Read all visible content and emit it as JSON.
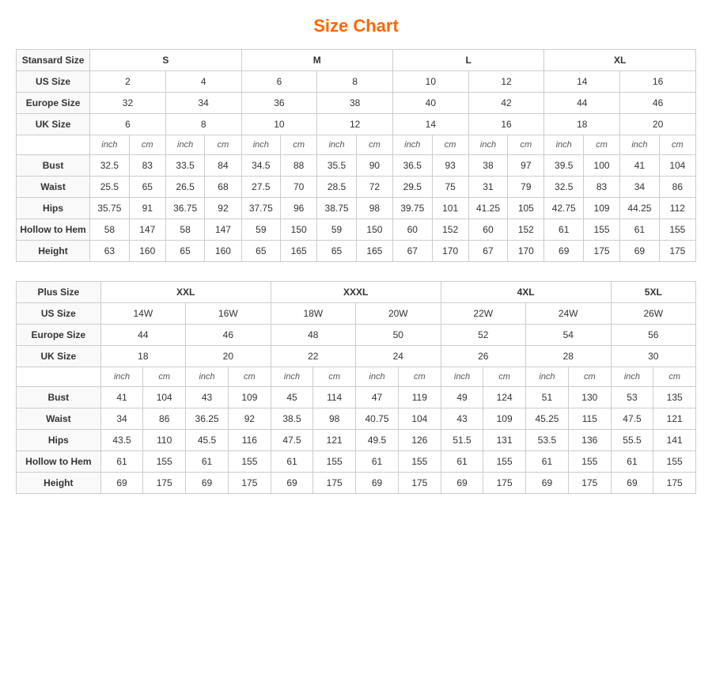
{
  "title": "Size Chart",
  "standard": {
    "label": "Stansard Size",
    "sizes": [
      "S",
      "M",
      "L",
      "XL"
    ],
    "us": [
      "2",
      "4",
      "6",
      "8",
      "10",
      "12",
      "14",
      "16"
    ],
    "europe": [
      "32",
      "34",
      "36",
      "38",
      "40",
      "42",
      "44",
      "46"
    ],
    "uk": [
      "6",
      "8",
      "10",
      "12",
      "14",
      "16",
      "18",
      "20"
    ],
    "measurements": {
      "bust": [
        "32.5",
        "83",
        "33.5",
        "84",
        "34.5",
        "88",
        "35.5",
        "90",
        "36.5",
        "93",
        "38",
        "97",
        "39.5",
        "100",
        "41",
        "104"
      ],
      "waist": [
        "25.5",
        "65",
        "26.5",
        "68",
        "27.5",
        "70",
        "28.5",
        "72",
        "29.5",
        "75",
        "31",
        "79",
        "32.5",
        "83",
        "34",
        "86"
      ],
      "hips": [
        "35.75",
        "91",
        "36.75",
        "92",
        "37.75",
        "96",
        "38.75",
        "98",
        "39.75",
        "101",
        "41.25",
        "105",
        "42.75",
        "109",
        "44.25",
        "112"
      ],
      "hollow": [
        "58",
        "147",
        "58",
        "147",
        "59",
        "150",
        "59",
        "150",
        "60",
        "152",
        "60",
        "152",
        "61",
        "155",
        "61",
        "155"
      ],
      "height": [
        "63",
        "160",
        "65",
        "160",
        "65",
        "165",
        "65",
        "165",
        "67",
        "170",
        "67",
        "170",
        "69",
        "175",
        "69",
        "175"
      ]
    }
  },
  "plus": {
    "label": "Plus Size",
    "sizes": [
      "XXL",
      "XXXL",
      "4XL",
      "5XL"
    ],
    "us": [
      "14W",
      "16W",
      "18W",
      "20W",
      "22W",
      "24W",
      "26W"
    ],
    "europe": [
      "44",
      "46",
      "48",
      "50",
      "52",
      "54",
      "56"
    ],
    "uk": [
      "18",
      "20",
      "22",
      "24",
      "26",
      "28",
      "30"
    ],
    "measurements": {
      "bust": [
        "41",
        "104",
        "43",
        "109",
        "45",
        "114",
        "47",
        "119",
        "49",
        "124",
        "51",
        "130",
        "53",
        "135"
      ],
      "waist": [
        "34",
        "86",
        "36.25",
        "92",
        "38.5",
        "98",
        "40.75",
        "104",
        "43",
        "109",
        "45.25",
        "115",
        "47.5",
        "121"
      ],
      "hips": [
        "43.5",
        "110",
        "45.5",
        "116",
        "47.5",
        "121",
        "49.5",
        "126",
        "51.5",
        "131",
        "53.5",
        "136",
        "55.5",
        "141"
      ],
      "hollow": [
        "61",
        "155",
        "61",
        "155",
        "61",
        "155",
        "61",
        "155",
        "61",
        "155",
        "61",
        "155",
        "61",
        "155"
      ],
      "height": [
        "69",
        "175",
        "69",
        "175",
        "69",
        "175",
        "69",
        "175",
        "69",
        "175",
        "69",
        "175",
        "69",
        "175"
      ]
    }
  },
  "row_labels": {
    "us_size": "US Size",
    "europe_size": "Europe Size",
    "uk_size": "UK Size",
    "bust": "Bust",
    "waist": "Waist",
    "hips": "Hips",
    "hollow": "Hollow to Hem",
    "height": "Height",
    "inch": "inch",
    "cm": "cm"
  }
}
